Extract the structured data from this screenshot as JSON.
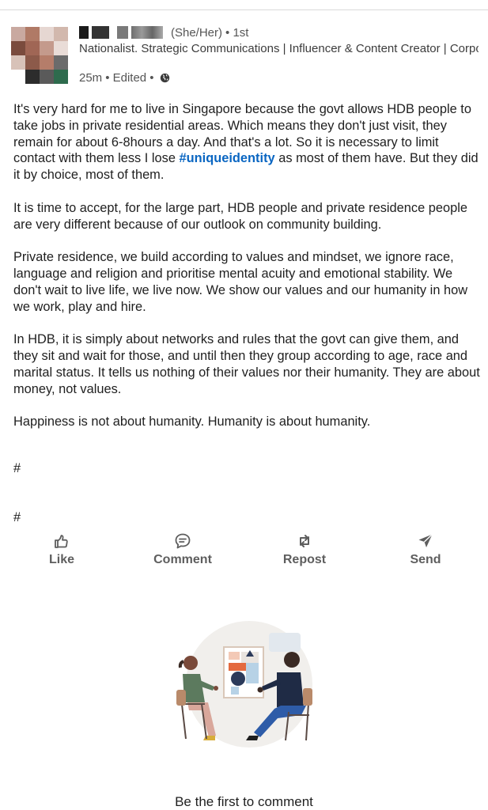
{
  "author": {
    "pronouns": "(She/Her)",
    "degree": "• 1st",
    "headline": "Nationalist. Strategic Communications | Influencer & Content Creator | Corporate Reputation Management | Brand strategic pil...",
    "time": "25m",
    "edited": "• Edited •",
    "visibility_icon": "globe-icon"
  },
  "post": {
    "p1_before": "It's very hard for me to live in Singapore because the govt allows HDB people to take jobs in private residential areas. Which means they don't just visit, they remain for about 6-8hours a day. And that's a lot. So it is necessary to limit contact with them less I lose ",
    "hashtag": "#uniqueidentity",
    "p1_after": " as most of them have. But they did it by choice, most of them.",
    "p2": "It is time to accept, for the large part, HDB people and private residence people are very different because of our outlook on community building.",
    "p3": "Private residence, we build according to values and mindset, we ignore race, language and religion and prioritise mental acuity and emotional stability. We don't wait to live life, we live now. We show our values and our humanity in how we work, play and hire.",
    "p4": "In HDB, it is simply about networks and rules that the govt can give them, and they sit and wait for those, and until then they group according to age, race and marital status. It tells us nothing of their values nor their humanity. They are about money, not values.",
    "p5": "Happiness is not about humanity. Humanity is about humanity.",
    "hash1": "#",
    "hash2": "#"
  },
  "actions": {
    "like": "Like",
    "comment": "Comment",
    "repost": "Repost",
    "send": "Send"
  },
  "comments": {
    "empty_text": "Be the first to comment"
  },
  "colors": {
    "hashtag": "#0a66c2",
    "action_gray": "#5e5e5e"
  }
}
